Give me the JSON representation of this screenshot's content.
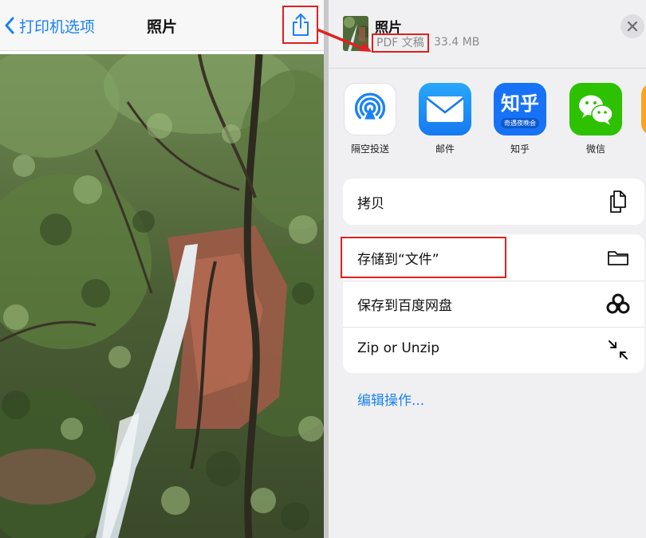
{
  "left": {
    "back_label": "打印机选项",
    "title": "照片"
  },
  "sheet": {
    "doc_title": "照片",
    "doc_type": "PDF 文稿",
    "doc_size": "33.4 MB",
    "apps": [
      {
        "label": "隔空投送",
        "icon": "airdrop-icon"
      },
      {
        "label": "邮件",
        "icon": "mail-icon"
      },
      {
        "label": "知乎",
        "icon": "zhihu-icon",
        "icon_text": "知乎",
        "icon_subtext": "奇遇夜晚会"
      },
      {
        "label": "微信",
        "icon": "wechat-icon"
      }
    ],
    "actions": [
      {
        "label": "拷贝",
        "icon": "copy-icon"
      },
      {
        "label": "存储到“文件”",
        "icon": "folder-icon"
      },
      {
        "label": "保存到百度网盘",
        "icon": "baidu-netdisk-icon"
      },
      {
        "label": "Zip or Unzip",
        "icon": "compress-icon"
      }
    ],
    "edit_actions": "编辑操作..."
  },
  "colors": {
    "accent": "#1a82f7",
    "highlight": "#e02020"
  }
}
